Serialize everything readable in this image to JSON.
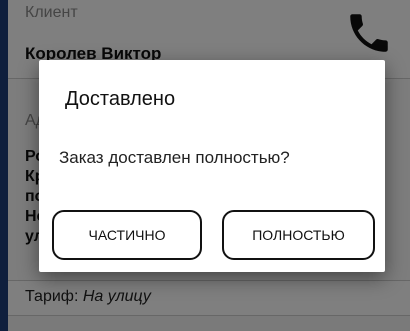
{
  "client": {
    "label": "Клиент",
    "name": "Королев Виктор",
    "phone_icon": "phone-icon"
  },
  "address": {
    "label": "Адрес",
    "lines": [
      "Ро",
      "Кр",
      "по",
      "Но",
      "ул"
    ]
  },
  "tariff": {
    "label": "Тариф:",
    "value": "На улицу"
  },
  "dialog": {
    "title": "Доставлено",
    "message": "Заказ доставлен полностью?",
    "partial_label": "ЧАСТИЧНО",
    "full_label": "ПОЛНОСТЬЮ"
  }
}
